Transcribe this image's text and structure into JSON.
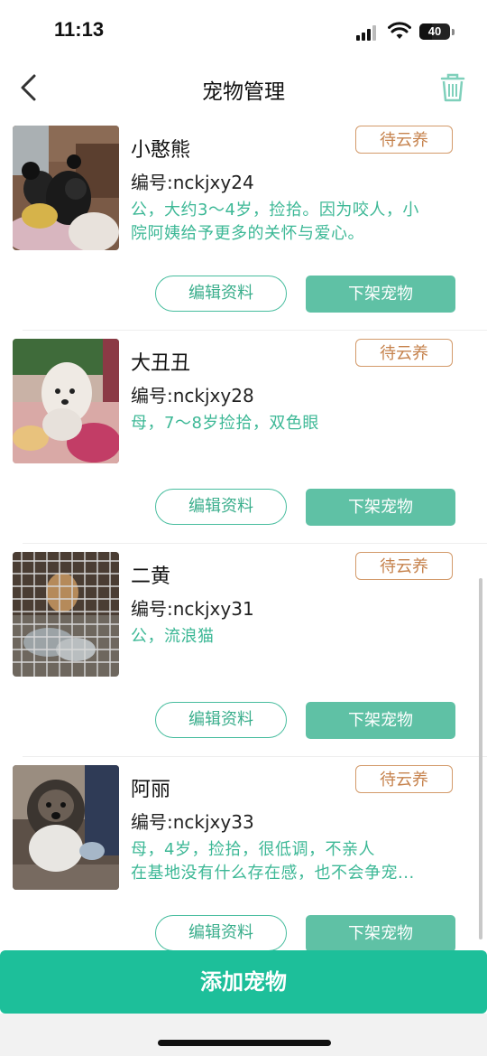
{
  "status_bar": {
    "time": "11:13",
    "battery": "40",
    "battery_level": 0.4,
    "icons": [
      "signal-icon",
      "wifi-icon",
      "battery-icon"
    ]
  },
  "nav": {
    "title": "宠物管理",
    "back_icon": "chevron-left-icon",
    "delete_icon": "trash-icon",
    "accent_color": "#5fc1a5"
  },
  "pets": [
    {
      "name": "小憨熊",
      "id": "编号:nckjxy24",
      "description_lines": [
        "公，大约3～4岁，捡拾。因为咬人，小",
        "院阿姨给予更多的关怀与爱心。"
      ],
      "status": "待云养",
      "edit_label": "编辑资料",
      "unlist_label": "下架宠物"
    },
    {
      "name": "大丑丑",
      "id": "编号:nckjxy28",
      "description_lines": [
        "母，7～8岁捡拾，双色眼"
      ],
      "status": "待云养",
      "edit_label": "编辑资料",
      "unlist_label": "下架宠物"
    },
    {
      "name": "二黄",
      "id": "编号:nckjxy31",
      "description_lines": [
        "公，流浪猫"
      ],
      "status": "待云养",
      "edit_label": "编辑资料",
      "unlist_label": "下架宠物"
    },
    {
      "name": "阿丽",
      "id": "编号:nckjxy33",
      "description_lines": [
        "母，4岁，捡拾，很低调，不亲人",
        "在基地没有什么存在感，也不会争宠..."
      ],
      "status": "待云养",
      "edit_label": "编辑资料",
      "unlist_label": "下架宠物"
    }
  ],
  "footer": {
    "add_label": "添加宠物"
  }
}
